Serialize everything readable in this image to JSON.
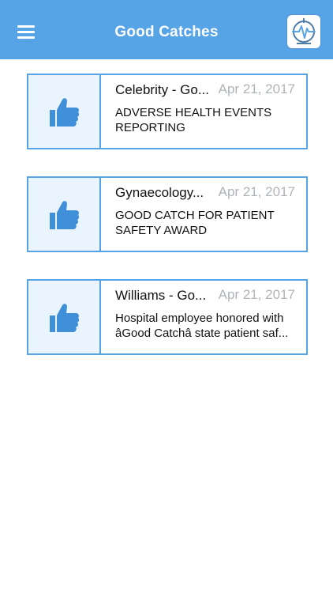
{
  "header": {
    "title": "Good Catches",
    "color": "#56a3e6",
    "menu_icon": "hamburger-menu-icon",
    "logo_icon": "app-logo-icon"
  },
  "catches": [
    {
      "icon": "thumbs-up-icon",
      "title": "Celebrity - Good Catch",
      "title_display": "Celebrity - Go...",
      "date": "Apr 21, 2017",
      "description": "ADVERSE HEALTH EVENTS REPORTING"
    },
    {
      "icon": "thumbs-up-icon",
      "title": "Gynaecology - Good Catch",
      "title_display": "Gynaecology...",
      "date": "Apr 21, 2017",
      "description": "GOOD CATCH FOR PATIENT SAFETY AWARD"
    },
    {
      "icon": "thumbs-up-icon",
      "title": "Williams - Good Catch",
      "title_display": "Williams - Go...",
      "date": "Apr 21, 2017",
      "description": "Hospital employee honored with âGood Catchâ state patient saf..."
    }
  ]
}
